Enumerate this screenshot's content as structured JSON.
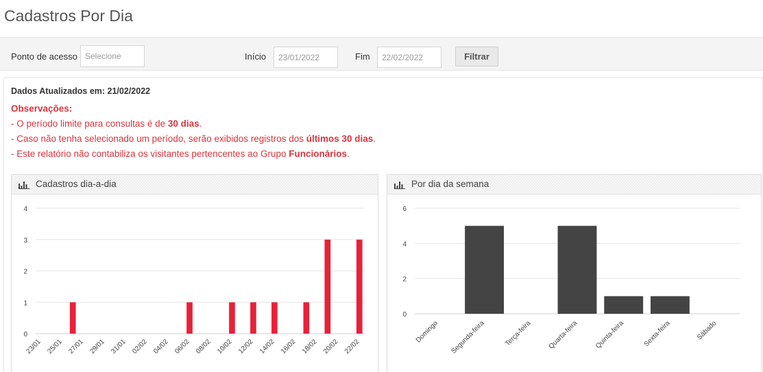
{
  "page": {
    "title": "Cadastros Por Dia"
  },
  "filters": {
    "access_point_label": "Ponto de acesso",
    "access_point_placeholder": "Selecione",
    "start_label": "Início",
    "start_value": "23/01/2022",
    "end_label": "Fim",
    "end_value": "22/02/2022",
    "filter_button": "Filtrar"
  },
  "info": {
    "updated": "Dados Atualizados em: 21/02/2022",
    "obs_title": "Observações:",
    "obs1_pre": "- O período limite para consultas é de ",
    "obs1_bold": "30 dias",
    "obs1_post": ".",
    "obs2_pre": "- Caso não tenha selecionado um período, serão exibidos registros dos ",
    "obs2_bold": "últimos 30 dias",
    "obs2_post": ".",
    "obs3_pre": "- Este relatório não contabiliza os visitantes pertencentes ao Grupo ",
    "obs3_bold": "Funcionários",
    "obs3_post": "."
  },
  "colors": {
    "accent_red": "#e8213a",
    "bar_dark": "#444444",
    "grid": "#e6e6e6"
  },
  "icons": {
    "panel": "bar-chart-icon"
  },
  "chart_data": [
    {
      "type": "bar",
      "title": "Cadastros dia-a-dia",
      "color": "#e8213a",
      "x_tick_labels": [
        "23/01",
        "25/01",
        "27/01",
        "29/01",
        "31/01",
        "02/02",
        "04/02",
        "06/02",
        "08/02",
        "10/02",
        "12/02",
        "14/02",
        "16/02",
        "18/02",
        "20/02",
        "22/02"
      ],
      "categories": [
        "23/01",
        "24/01",
        "25/01",
        "26/01",
        "27/01",
        "28/01",
        "29/01",
        "30/01",
        "31/01",
        "01/02",
        "02/02",
        "03/02",
        "04/02",
        "05/02",
        "06/02",
        "07/02",
        "08/02",
        "09/02",
        "10/02",
        "11/02",
        "12/02",
        "13/02",
        "14/02",
        "15/02",
        "16/02",
        "17/02",
        "18/02",
        "19/02",
        "20/02",
        "21/02",
        "22/02"
      ],
      "values": [
        0,
        0,
        0,
        1,
        0,
        0,
        0,
        0,
        0,
        0,
        0,
        0,
        0,
        0,
        1,
        0,
        0,
        0,
        1,
        0,
        1,
        0,
        1,
        0,
        0,
        1,
        0,
        3,
        0,
        0,
        3
      ],
      "yticks": [
        0,
        1,
        2,
        3,
        4
      ],
      "ylim": [
        0,
        4
      ],
      "grid": true
    },
    {
      "type": "bar",
      "title": "Por dia da semana",
      "color": "#444444",
      "categories": [
        "Domingo",
        "Segunda-feira",
        "Terça-feira",
        "Quarta-feira",
        "Quinta-feira",
        "Sexta-feira",
        "Sábado"
      ],
      "values": [
        0,
        5,
        0,
        5,
        1,
        1,
        0
      ],
      "yticks": [
        0,
        2,
        4,
        6
      ],
      "ylim": [
        0,
        6
      ],
      "grid": true
    }
  ]
}
